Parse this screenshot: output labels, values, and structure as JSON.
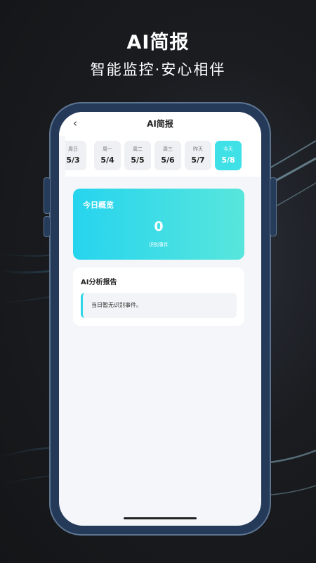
{
  "promo": {
    "headline": "AI简报",
    "subline": "智能监控·安心相伴"
  },
  "nav": {
    "back_icon": "chevron-left-icon",
    "back_glyph": "‹",
    "title": "AI简报"
  },
  "days": [
    {
      "weekday": "周日",
      "date": "5/3",
      "active": false
    },
    {
      "weekday": "周一",
      "date": "5/4",
      "active": false
    },
    {
      "weekday": "周二",
      "date": "5/5",
      "active": false
    },
    {
      "weekday": "周三",
      "date": "5/6",
      "active": false
    },
    {
      "weekday": "昨天",
      "date": "5/7",
      "active": false
    },
    {
      "weekday": "今天",
      "date": "5/8",
      "active": true
    }
  ],
  "summary": {
    "title": "今日概览",
    "count": "0",
    "count_label": "识别事件"
  },
  "report": {
    "title": "AI分析报告",
    "message": "当日暂无识别事件。"
  },
  "colors": {
    "accent": "#3fe0e6",
    "phone_frame": "#243a58",
    "background": "#1a1c20"
  }
}
